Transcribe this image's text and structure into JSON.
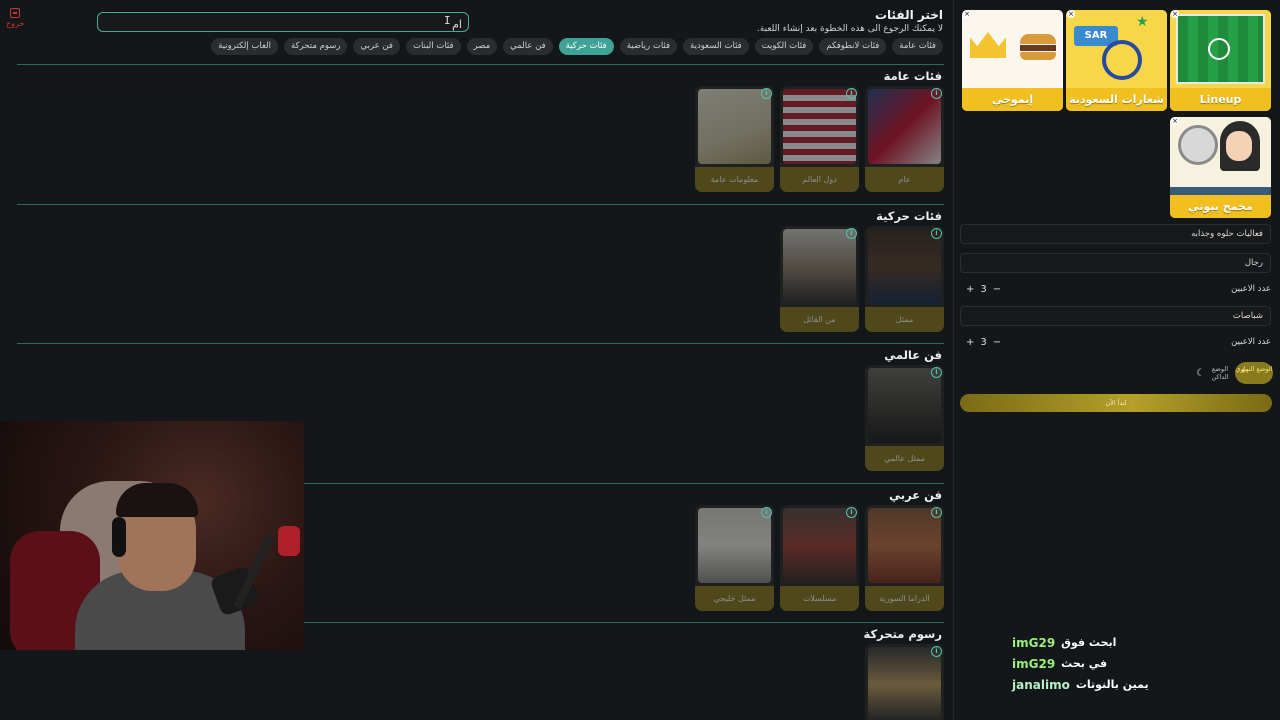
{
  "logout": {
    "label": "خروج"
  },
  "search": {
    "value": "ام"
  },
  "header": {
    "title": "اختر الفئات",
    "subtitle": "لا يمكنك الرجوع الى هذه الخطوة بعد إنشاء اللعبة."
  },
  "chips": [
    {
      "label": "فئات عامة",
      "active": false
    },
    {
      "label": "فئات لانطوفكم",
      "active": false
    },
    {
      "label": "فئات الكويت",
      "active": false
    },
    {
      "label": "فئات السعودية",
      "active": false
    },
    {
      "label": "فئات رياضية",
      "active": false
    },
    {
      "label": "فئات حركية",
      "active": true
    },
    {
      "label": "فن عالمي",
      "active": false
    },
    {
      "label": "مصر",
      "active": false
    },
    {
      "label": "فئات البنات",
      "active": false
    },
    {
      "label": "فن عربي",
      "active": false
    },
    {
      "label": "رسوم متحركة",
      "active": false
    },
    {
      "label": "العاب إلكترونية",
      "active": false
    }
  ],
  "sections": [
    {
      "title": "فئات عامة",
      "cards": [
        "عام",
        "دول العالم",
        "معلومات عامة"
      ]
    },
    {
      "title": "فئات حركية",
      "cards": [
        "ممثل",
        "من القائل"
      ]
    },
    {
      "title": "فن عالمي",
      "cards": [
        "ممثل عالمي"
      ]
    },
    {
      "title": "فن عربي",
      "cards": [
        "الدراما السورية",
        "مسلسلات",
        "ممثل خليجي"
      ]
    },
    {
      "title": "رسوم متحركة",
      "cards": []
    }
  ],
  "selected": [
    {
      "label": "Lineup"
    },
    {
      "label": "شعارات السعودية"
    },
    {
      "label": "إيموجي"
    },
    {
      "label": "مخمخ بيوتي"
    }
  ],
  "form": {
    "game_name": "فعاليات حلوه وجذابه",
    "team1_name": "رجال",
    "team2_name": "شباصات",
    "players_label": "عدد الاعبين",
    "team1_players": "3",
    "team2_players": "3"
  },
  "theme": {
    "dark": "الوضع الداكن",
    "light": "الوضع النهاري"
  },
  "start_button": "ابدأ الآن",
  "chat": [
    {
      "user": "imG29",
      "text": "ابحث فوق",
      "color": "#9af07a"
    },
    {
      "user": "imG29",
      "text": "في بحث",
      "color": "#9af07a"
    },
    {
      "user": "janalimo",
      "text": "يمين بالنوتات",
      "color": "#b6f0c8"
    }
  ]
}
